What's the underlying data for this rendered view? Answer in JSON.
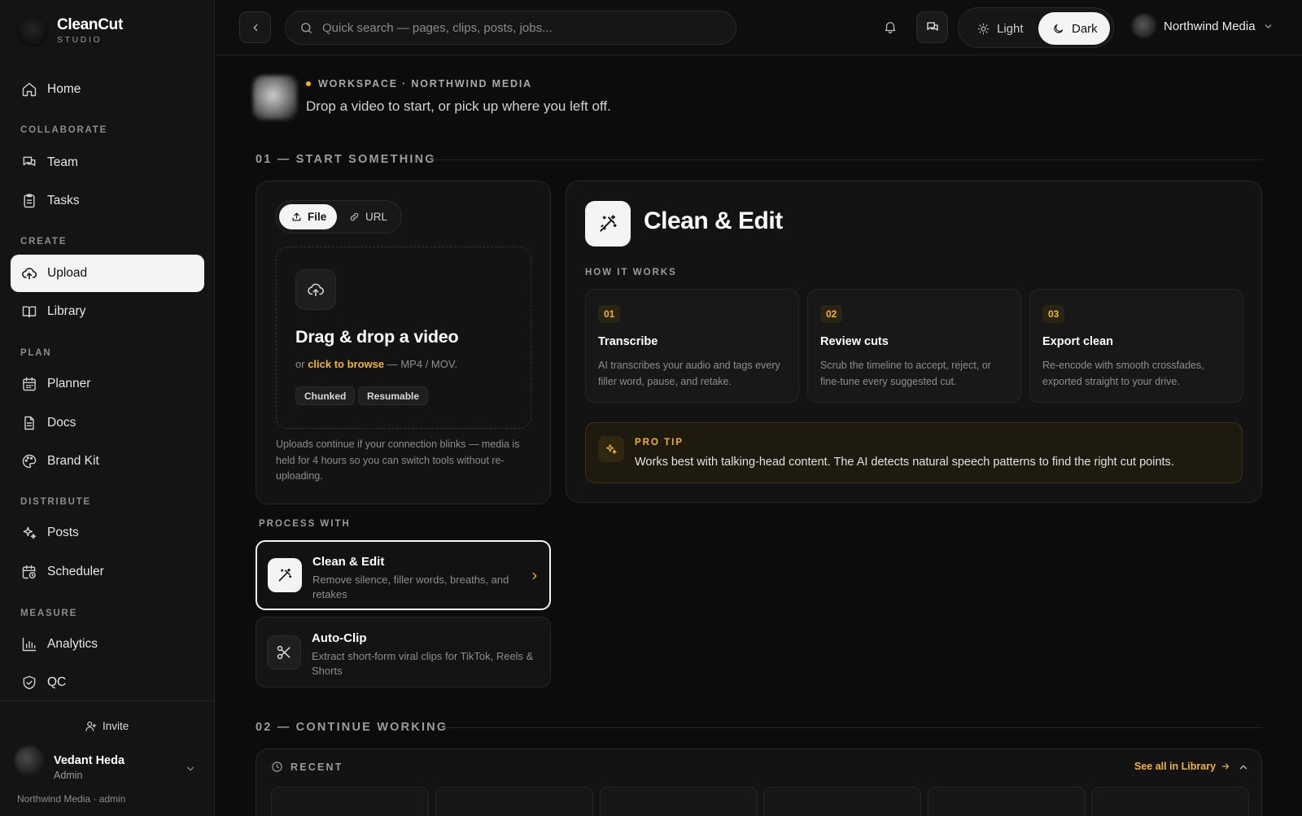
{
  "brand": {
    "name": "CleanCut",
    "sub": "STUDIO"
  },
  "sidebar": {
    "home": "Home",
    "sections": {
      "collaborate": "COLLABORATE",
      "create": "CREATE",
      "plan": "PLAN",
      "distribute": "DISTRIBUTE",
      "measure": "MEASURE"
    },
    "items": {
      "team": "Team",
      "tasks": "Tasks",
      "upload": "Upload",
      "library": "Library",
      "planner": "Planner",
      "docs": "Docs",
      "brand_kit": "Brand Kit",
      "posts": "Posts",
      "scheduler": "Scheduler",
      "analytics": "Analytics",
      "qc": "QC"
    },
    "invite": "Invite",
    "user": {
      "name": "Vedant Heda",
      "role": "Admin"
    },
    "org_line": "Northwind Media · admin"
  },
  "topbar": {
    "search_placeholder": "Quick search — pages, clips, posts, jobs...",
    "theme": {
      "light": "Light",
      "dark": "Dark",
      "selected": "Dark"
    },
    "account_name": "Northwind Media"
  },
  "workspace": {
    "label": "WORKSPACE · NORTHWIND MEDIA",
    "description": "Drop a video to start, or pick up where you left off."
  },
  "sections": {
    "start": "01 — START SOMETHING",
    "continue": "02 — CONTINUE WORKING"
  },
  "upload": {
    "tabs": {
      "file": "File",
      "url": "URL"
    },
    "drop_title": "Drag & drop a video",
    "drop_prefix": "or",
    "drop_link": "click to browse",
    "drop_suffix": "— MP4 / MOV.",
    "chips": [
      "Chunked",
      "Resumable"
    ],
    "note": "Uploads continue if your connection blinks — media is held for 4 hours so you can switch tools without re-uploading."
  },
  "clean_edit": {
    "title": "Clean & Edit",
    "how_it_works": "HOW IT WORKS",
    "steps": [
      {
        "num": "01",
        "title": "Transcribe",
        "desc": "AI transcribes your audio and tags every filler word, pause, and retake."
      },
      {
        "num": "02",
        "title": "Review cuts",
        "desc": "Scrub the timeline to accept, reject, or fine-tune every suggested cut."
      },
      {
        "num": "03",
        "title": "Export clean",
        "desc": "Re-encode with smooth crossfades, exported straight to your drive."
      }
    ],
    "tip_label": "PRO TIP",
    "tip_text": "Works best with talking-head content. The AI detects natural speech patterns to find the right cut points."
  },
  "process_with": {
    "label": "PROCESS WITH",
    "options": [
      {
        "title": "Clean & Edit",
        "desc": "Remove silence, filler words, breaths, and retakes"
      },
      {
        "title": "Auto-Clip",
        "desc": "Extract short-form viral clips for TikTok, Reels & Shorts"
      }
    ]
  },
  "recent": {
    "label": "RECENT",
    "see_all": "See all in Library"
  },
  "colors": {
    "accent": "#f0b429",
    "background": "#0c0c0c",
    "surface": "#131313",
    "active": "#f4f4f4"
  }
}
